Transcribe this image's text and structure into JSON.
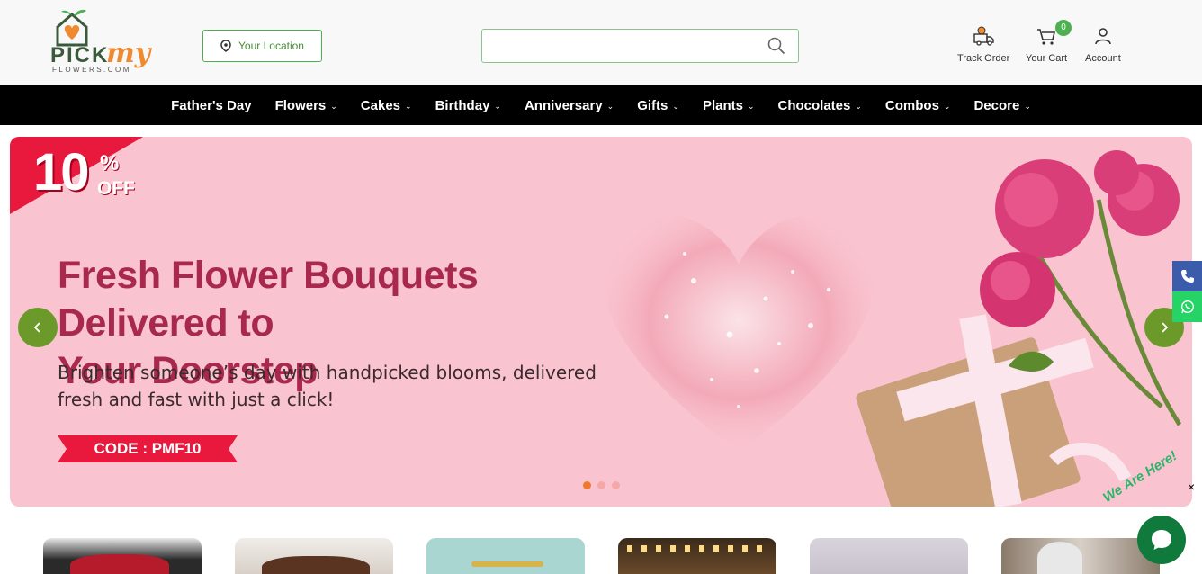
{
  "logo": {
    "main": "PICK",
    "accent": "my",
    "sub": "FLOWERS.COM"
  },
  "header": {
    "location_label": "Your Location",
    "search_placeholder": "",
    "track_order": "Track Order",
    "cart_label": "Your Cart",
    "cart_count": "0",
    "account": "Account"
  },
  "nav": [
    {
      "label": "Father's Day",
      "dropdown": false
    },
    {
      "label": "Flowers",
      "dropdown": true
    },
    {
      "label": "Cakes",
      "dropdown": true
    },
    {
      "label": "Birthday",
      "dropdown": true
    },
    {
      "label": "Anniversary",
      "dropdown": true
    },
    {
      "label": "Gifts",
      "dropdown": true
    },
    {
      "label": "Plants",
      "dropdown": true
    },
    {
      "label": "Chocolates",
      "dropdown": true
    },
    {
      "label": "Combos",
      "dropdown": true
    },
    {
      "label": "Decore",
      "dropdown": true
    }
  ],
  "banner": {
    "discount_number": "10",
    "discount_percent": "%",
    "discount_off": "OFF",
    "headline_1": "Fresh Flower Bouquets Delivered to",
    "headline_2": "Your Doorstep",
    "subline_1": "Brighten someone’s day with handpicked blooms, delivered",
    "subline_2": "fresh and fast with just a click!",
    "code": "CODE : PMF10",
    "slide_count": 3,
    "active_slide": 1,
    "prev_icon": "chevron-left-icon",
    "next_icon": "chevron-right-icon"
  },
  "chat_widget": {
    "tagline": "We Are Here!",
    "close": "×"
  },
  "colors": {
    "brand_green": "#4caf50",
    "brand_orange": "#f08a30",
    "nav_bg": "#000000",
    "banner_bg": "#f9c3cf",
    "headline": "#a8294d",
    "ribbon_red": "#e8193c",
    "arrow_green": "#6b9a2b",
    "phone_blue": "#3b5bab",
    "whatsapp_green": "#25d366"
  }
}
